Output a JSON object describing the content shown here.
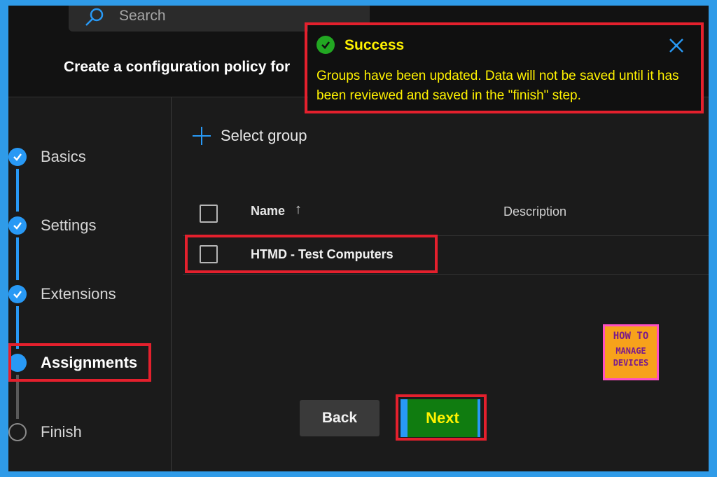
{
  "search": {
    "placeholder": "Search"
  },
  "header": {
    "title": "Create a configuration policy for"
  },
  "steps": [
    {
      "label": "Basics",
      "state": "completed"
    },
    {
      "label": "Settings",
      "state": "completed"
    },
    {
      "label": "Extensions",
      "state": "completed"
    },
    {
      "label": "Assignments",
      "state": "current"
    },
    {
      "label": "Finish",
      "state": "pending"
    }
  ],
  "main": {
    "select_group_label": "Select group",
    "table": {
      "columns": [
        "Name",
        "Description"
      ],
      "sort_indicator": "↑",
      "rows": [
        {
          "name": "HTMD - Test Computers",
          "description": ""
        }
      ]
    }
  },
  "footer": {
    "back_label": "Back",
    "next_label": "Next"
  },
  "toast": {
    "title": "Success",
    "message": "Groups have been updated. Data will not be saved until it has been reviewed and saved in the \"finish\" step."
  },
  "logo": {
    "line1": "HOW TO",
    "line2": "MANAGE",
    "line3": "DEVICES"
  },
  "colors": {
    "accent": "#2899f5",
    "highlight": "#e4202d",
    "next_button": "#107c10",
    "toast_text": "#fff200",
    "frame": "#2f9be8"
  }
}
